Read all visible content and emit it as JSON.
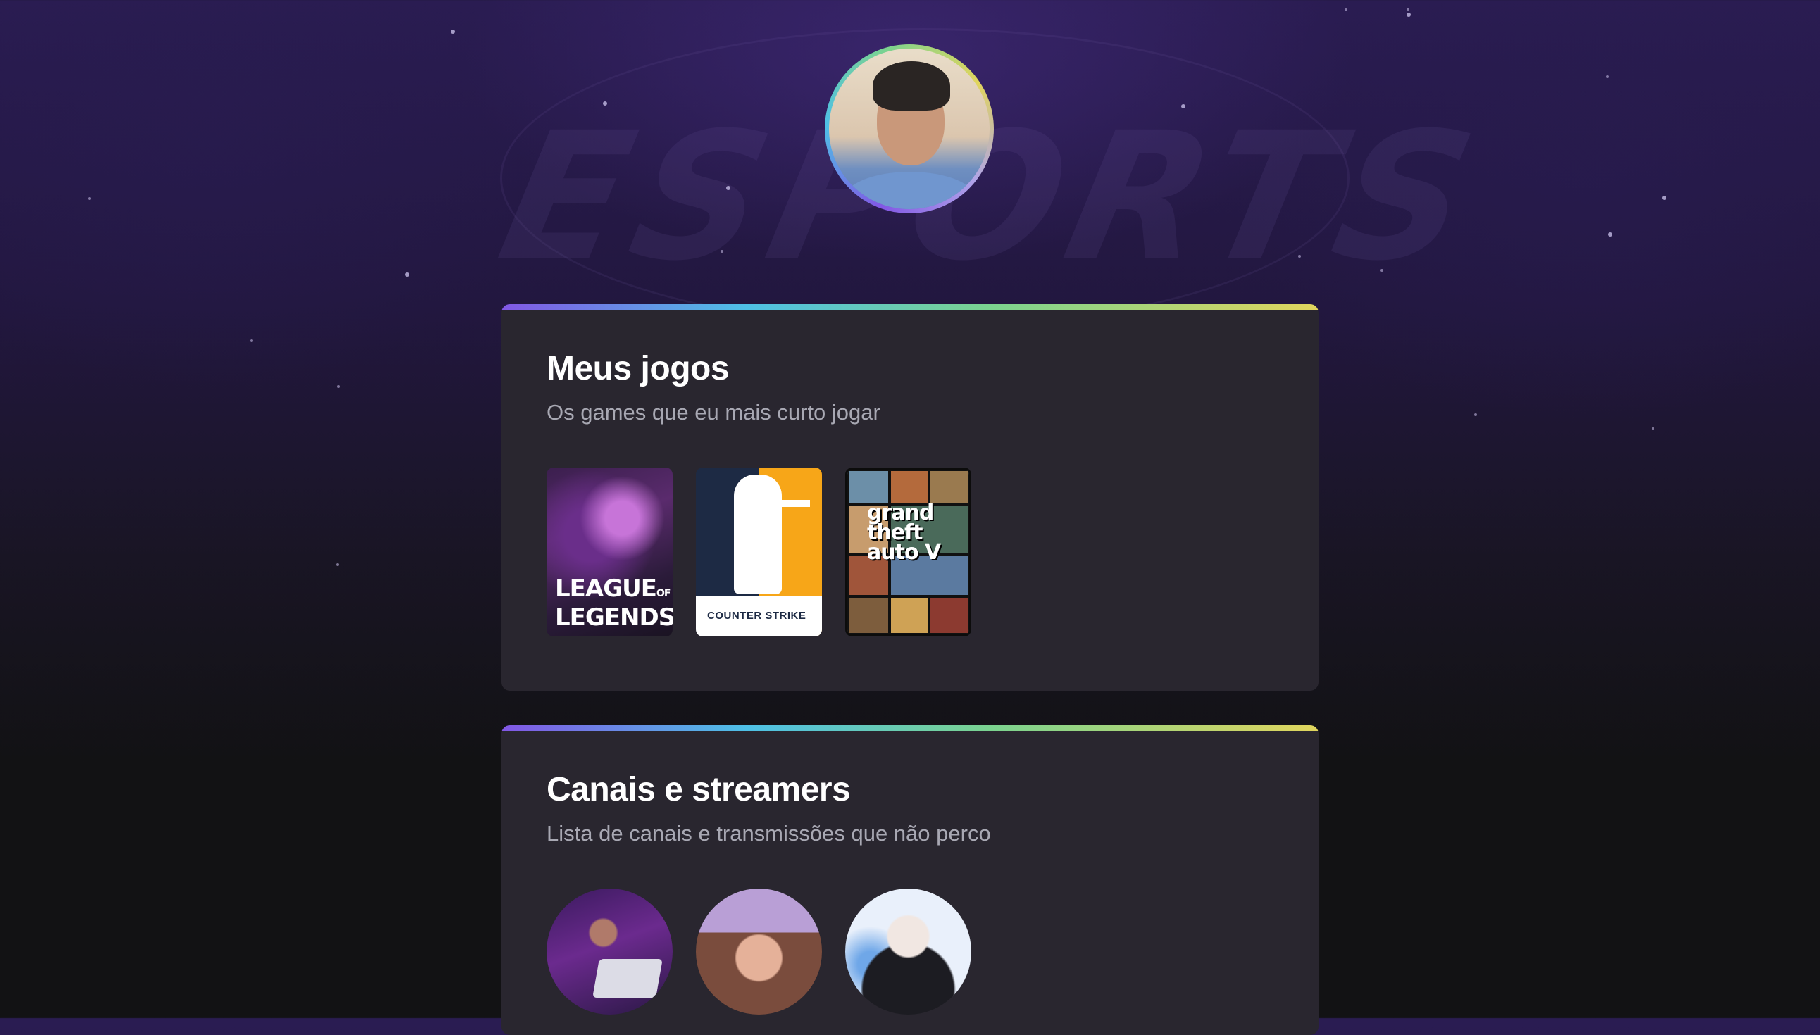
{
  "background": {
    "wordmark": "ESPORTS"
  },
  "profile": {
    "avatar_alt": "Foto de perfil"
  },
  "sections": {
    "games": {
      "title": "Meus jogos",
      "subtitle": "Os games que eu mais curto jogar",
      "items": [
        {
          "name": "League of Legends",
          "cover_text_1": "LEAGUE",
          "cover_text_of": "OF",
          "cover_text_2": "LEGENDS"
        },
        {
          "name": "Counter-Strike",
          "cover_text": "COUNTER STRIKE"
        },
        {
          "name": "Grand Theft Auto V",
          "cover_text": "grand theft auto V"
        }
      ]
    },
    "streamers": {
      "title": "Canais e streamers",
      "subtitle": "Lista de canais e transmissões que não perco",
      "items": [
        {
          "name": "streamer-1"
        },
        {
          "name": "streamer-2"
        },
        {
          "name": "streamer-3"
        }
      ]
    }
  },
  "colors": {
    "gradient": [
      "#8257e5",
      "#4ec0e6",
      "#7bd38f",
      "#e1d55d"
    ],
    "card_bg": "#29262f",
    "page_bg": "#121214",
    "title": "#ffffff",
    "subtitle": "#a8a8b3"
  }
}
